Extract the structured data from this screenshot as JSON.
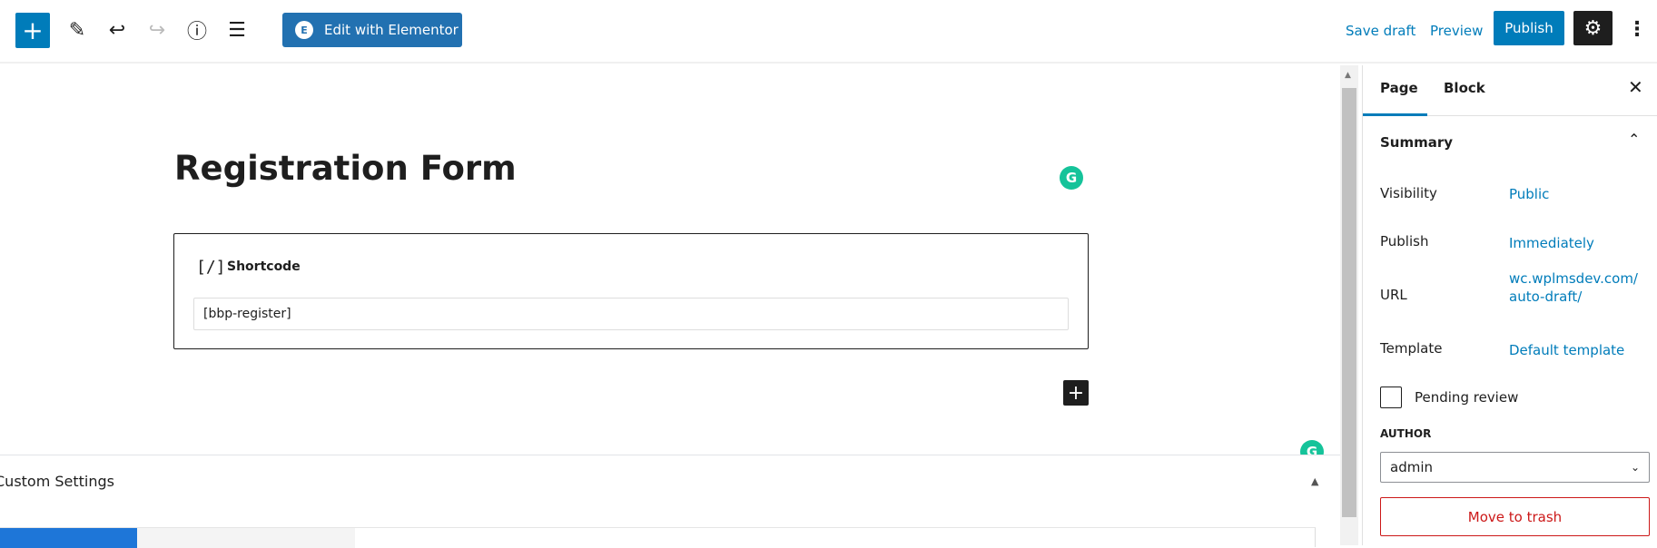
{
  "toolbar": {
    "add_icon": "plus-icon",
    "tools_icon": "pencil-icon",
    "undo_icon": "undo-icon",
    "redo_icon": "redo-icon",
    "info_icon": "info-icon",
    "outline_icon": "list-view-icon",
    "elementor_label": "Edit with Elementor",
    "elementor_logo": "E",
    "save_draft": "Save draft",
    "preview": "Preview",
    "publish": "Publish",
    "settings_icon": "gear-icon",
    "more_icon": "vertical-dots-icon",
    "accent": "#007cba"
  },
  "editor": {
    "title": "Registration Form",
    "block": {
      "icon": "[/]",
      "label": "Shortcode",
      "value": "[bbp-register]"
    },
    "grammarly_icon": "G"
  },
  "meta_box": {
    "label": "Custom Settings"
  },
  "sidebar": {
    "tabs": [
      {
        "label": "Page",
        "active": true
      },
      {
        "label": "Block",
        "active": false
      }
    ],
    "close_icon": "close-icon",
    "summary": {
      "title": "Summary",
      "rows": [
        {
          "label": "Visibility",
          "value": "Public"
        },
        {
          "label": "Publish",
          "value": "Immediately"
        },
        {
          "label": "URL",
          "value": "wc.wplmsdev.com/auto-draft/"
        },
        {
          "label": "Template",
          "value": "Default template"
        }
      ],
      "pending_review": "Pending review",
      "pending_checked": false,
      "author_label": "AUTHOR",
      "author_value": "admin",
      "trash": "Move to trash"
    }
  }
}
